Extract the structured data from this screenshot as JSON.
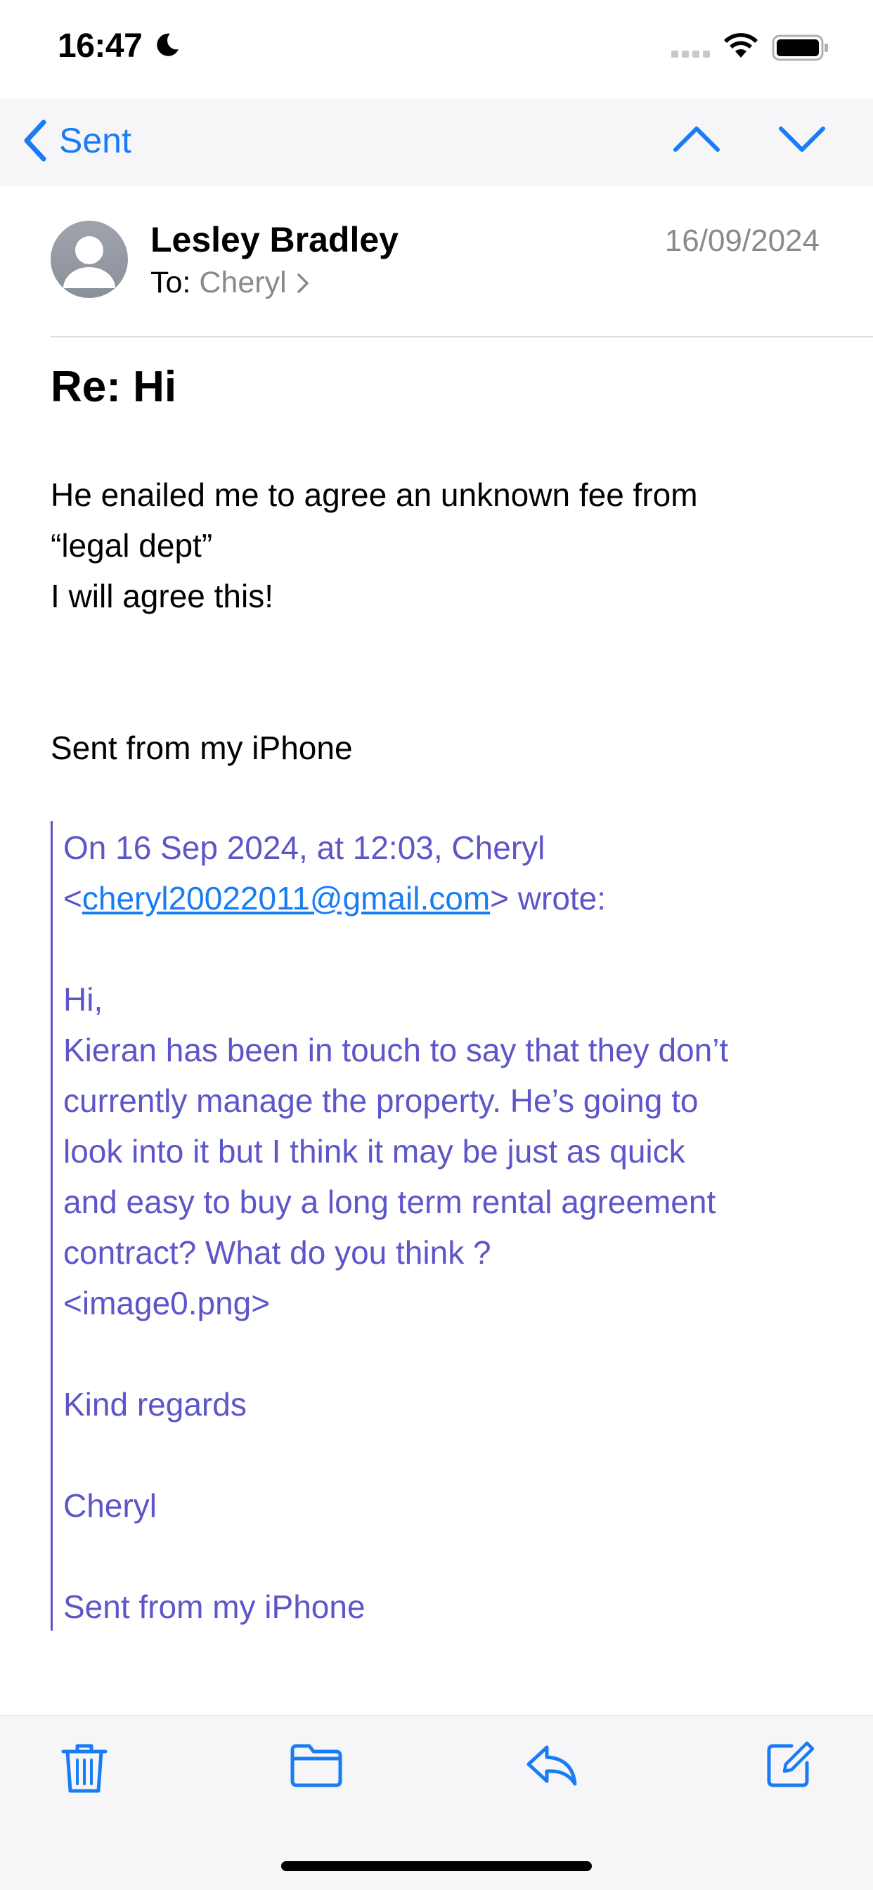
{
  "status_bar": {
    "time": "16:47"
  },
  "nav": {
    "back_label": "Sent"
  },
  "message": {
    "sender": "Lesley Bradley",
    "to_label": "To:",
    "to_recipient": "Cheryl",
    "date": "16/09/2024",
    "subject": "Re: Hi",
    "body_lines": [
      "He enailed me to agree an unknown fee from",
      "“legal dept”",
      "I will agree this!"
    ],
    "signature": "Sent from my iPhone"
  },
  "quote": {
    "header_line1": "On 16 Sep 2024, at 12:03, Cheryl",
    "header_open": "<",
    "email": "cheryl20022011@gmail.com",
    "header_close": "> wrote:",
    "greeting": "Hi,",
    "paragraph_lines": [
      "Kieran has been in touch to say that they don’t",
      "currently manage the property. He’s going to",
      "look into it but I think it may be just as quick",
      "and easy to buy a long term rental agreement",
      "contract? What do you think ?",
      "<image0.png>"
    ],
    "regards": "Kind regards",
    "name": "Cheryl",
    "signature": "Sent from my iPhone"
  },
  "icons": {
    "toolbar": [
      "trash-icon",
      "folder-icon",
      "reply-icon",
      "compose-icon"
    ],
    "nav": [
      "chevron-left-icon",
      "chevron-up-icon",
      "chevron-down-icon"
    ]
  },
  "colors": {
    "accent": "#1a7cf5",
    "quote": "#5d56c8",
    "secondary": "#8a8a8e"
  }
}
